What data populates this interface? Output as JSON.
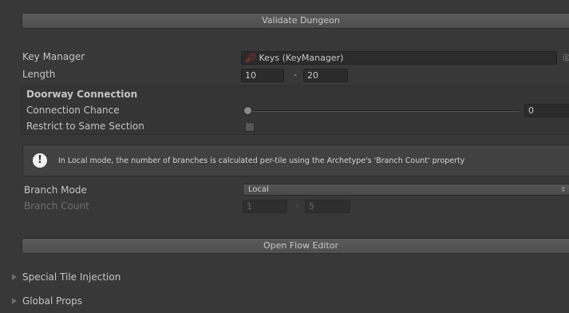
{
  "buttons": {
    "validate": "Validate Dungeon",
    "open_flow": "Open Flow Editor"
  },
  "key_manager": {
    "label": "Key Manager",
    "value": "Keys (KeyManager)",
    "icon": "key-icon"
  },
  "length": {
    "label": "Length",
    "min": "10",
    "separator": "-",
    "max": "20"
  },
  "doorway": {
    "header": "Doorway Connection",
    "chance_label": "Connection Chance",
    "chance_value": "0",
    "chance_fraction": 0,
    "restrict_label": "Restrict to Same Section",
    "restrict_checked": false
  },
  "help": {
    "icon": "info-icon",
    "text": "In Local mode, the number of branches is calculated per-tile using the Archetype's 'Branch Count' property"
  },
  "branch": {
    "mode_label": "Branch Mode",
    "mode_value": "Local",
    "count_label": "Branch Count",
    "count_min": "1",
    "separator": "-",
    "count_max": "5"
  },
  "foldouts": {
    "special": "Special Tile Injection",
    "global": "Global Props"
  },
  "colors": {
    "background": "#383838",
    "key_icon": "#e0423a"
  }
}
